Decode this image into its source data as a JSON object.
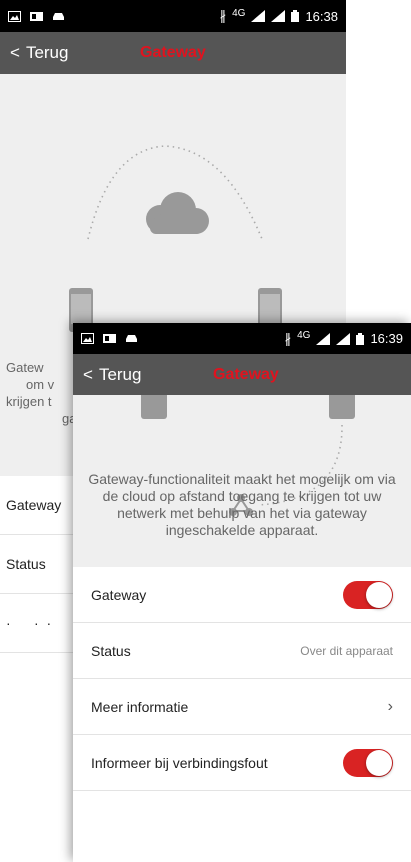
{
  "back_screen": {
    "status_bar": {
      "time": "16:38",
      "network": "4G"
    },
    "app_bar": {
      "back_label": "Terug",
      "title": "Gateway"
    },
    "description_partial": [
      "Gatew",
      "om v",
      "krijgen t",
      "ga"
    ],
    "rows": [
      {
        "label": "Gateway"
      },
      {
        "label": "Status"
      }
    ]
  },
  "front_screen": {
    "status_bar": {
      "time": "16:39",
      "network": "4G"
    },
    "app_bar": {
      "back_label": "Terug",
      "title": "Gateway"
    },
    "description": "Gateway-functionaliteit maakt het mogelijk om via de cloud op afstand toegang te krijgen tot uw netwerk met behulp van het via gateway ingeschakelde apparaat.",
    "rows": {
      "gateway": {
        "label": "Gateway",
        "toggle_on": true
      },
      "status": {
        "label": "Status",
        "value": "Over dit apparaat"
      },
      "more_info": {
        "label": "Meer informatie",
        "chevron": "›"
      },
      "notify": {
        "label": "Informeer bij verbindingsfout",
        "toggle_on": true
      }
    }
  },
  "colors": {
    "accent": "#e0131f",
    "toggle_on": "#d92323",
    "app_bar": "#555555",
    "hero_bg": "#efefef"
  },
  "icons": [
    "image-icon",
    "sim-icon",
    "car-icon",
    "bluetooth-icon",
    "signal-icon",
    "battery-icon",
    "cloud-icon",
    "phone-icon",
    "gateway-node-icon",
    "chevron-left-icon",
    "chevron-right-icon"
  ]
}
